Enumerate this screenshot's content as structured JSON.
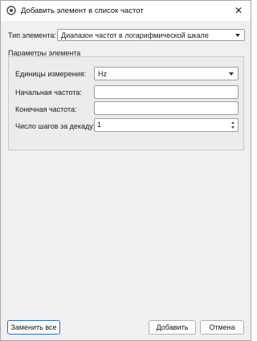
{
  "window": {
    "title": "Добавить элемент в список частот",
    "icon": "app-gear-icon"
  },
  "type_row": {
    "label": "Тип элемента:",
    "value": "Диапазон частот в логарифмической шкале"
  },
  "params": {
    "group_title": "Параметры элемента",
    "units_label": "Единицы измерения:",
    "units_value": "Hz",
    "start_label": "Начальная частота:",
    "start_value": "",
    "end_label": "Конечная частота:",
    "end_value": "",
    "steps_label": "Число шагов за декаду:",
    "steps_value": "1"
  },
  "buttons": {
    "replace_all": "Заменить все",
    "add": "Добавить",
    "cancel": "Отмена"
  }
}
